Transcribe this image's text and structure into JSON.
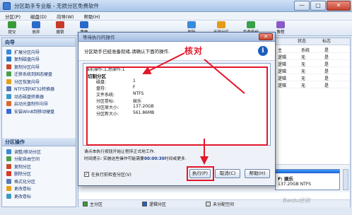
{
  "window": {
    "title": "分区助手专业版 - 无损分区免费软件",
    "buttons": [
      "—",
      "□",
      "✕"
    ]
  },
  "menu": [
    "分区(P)",
    "磁盘(D)",
    "向导(W)",
    "帮助(H)"
  ],
  "toolbar": {
    "left": [
      {
        "label": "提交",
        "icon": "check-icon",
        "color": "#3a9a3a"
      },
      {
        "label": "放弃",
        "icon": "undo-icon",
        "color": "#2a6ac8"
      },
      {
        "label": "撤销",
        "icon": "back-arrow-icon",
        "color": "#c83a2a"
      },
      {
        "label": "重做",
        "icon": "redo-icon",
        "color": "#2a6ac8"
      }
    ],
    "right": [
      {
        "label": "刷新",
        "icon": "refresh-icon",
        "color": "#3a8ad8"
      },
      {
        "label": "无损分区",
        "icon": "partition-icon",
        "color": "#e69a1a"
      },
      {
        "label": "免费备份",
        "icon": "backup-icon",
        "color": "#3aa04a"
      },
      {
        "label": "教程",
        "icon": "book-icon",
        "color": "#8a5ac8"
      }
    ]
  },
  "sidebar": {
    "wizard_title": "向导",
    "wizard_items": [
      {
        "label": "扩展分区向导",
        "color": "#3a8ad8"
      },
      {
        "label": "复制磁盘向导",
        "color": "#2a7ac8"
      },
      {
        "label": "复制分区向导",
        "color": "#c84a2a"
      },
      {
        "label": "迁移系统到固态硬盘",
        "color": "#4aa04a"
      },
      {
        "label": "分区恢复向导",
        "color": "#e6a01a"
      },
      {
        "label": "NTFS到FAT32转换器",
        "color": "#5a7ab8"
      },
      {
        "label": "动态磁盘转换器",
        "color": "#3a9ac8"
      },
      {
        "label": "启动光盘制作向导",
        "color": "#d86a2a"
      },
      {
        "label": "安装Win8到移动硬盘",
        "color": "#3a6ad8"
      }
    ],
    "ops_title": "分区操作",
    "ops_items": [
      {
        "label": "调整/移动分区",
        "color": "#3a8ad8"
      },
      {
        "label": "分配自由空间",
        "color": "#4aa04a"
      },
      {
        "label": "复制分区",
        "color": "#c84a2a"
      },
      {
        "label": "删除分区",
        "color": "#d83a2a"
      },
      {
        "label": "格式化分区",
        "color": "#5a7ab8"
      },
      {
        "label": "更改卷标",
        "color": "#e6a01a"
      },
      {
        "label": "更改卷标",
        "color": "#3a9ac8"
      }
    ]
  },
  "table": {
    "headers": [
      "状态",
      "标志"
    ],
    "rows": [
      [
        "系统",
        "是"
      ],
      [
        "无",
        "是"
      ],
      [
        "无",
        "是"
      ],
      [
        "无",
        "是"
      ],
      [
        "无",
        "是"
      ],
      [
        "无",
        "是"
      ]
    ],
    "type_col": [
      "主",
      "逻辑",
      "逻辑",
      "逻辑",
      "逻辑",
      "逻辑"
    ]
  },
  "diskmap": {
    "partition_name": "F: 娱乐",
    "partition_size": "137.20GB NTFS"
  },
  "legend": [
    "主分区",
    "逻辑分区",
    "未分配空间"
  ],
  "legend_colors": [
    "#3a9a3a",
    "#1a5fcf",
    "#d8d8d8"
  ],
  "dialog": {
    "title": "等待执行的操作",
    "header_msg": "分区助手已经准备就绪,请确认下面的操作.",
    "annotation": "核对",
    "ops_header": "当前操作:1,总操作:1",
    "op_title": "切割分区",
    "op_fields": [
      [
        "磁盘:",
        "1"
      ],
      [
        "盘符:",
        "F"
      ],
      [
        "文件系统:",
        "NTFS"
      ],
      [
        "分区卷标:",
        "娱乐"
      ],
      [
        "分区原大小:",
        "137.20GB"
      ],
      [
        "分区新大小:",
        "561.86MB"
      ]
    ],
    "note1": "请点击执行按钮开始让程序正式地工作.",
    "note2_prefix": "时间提示: 实施这些操作可能需要",
    "note2_time": "00:00:30",
    "note2_suffix": "时间或更多.",
    "checkbox_label": "在执行前检查分区(V)",
    "checkbox_checked": true,
    "btn_exec": "执行(P)",
    "btn_cancel": "取消(C)",
    "btn_help": "帮助(H)"
  },
  "watermark": "Baidu经验"
}
